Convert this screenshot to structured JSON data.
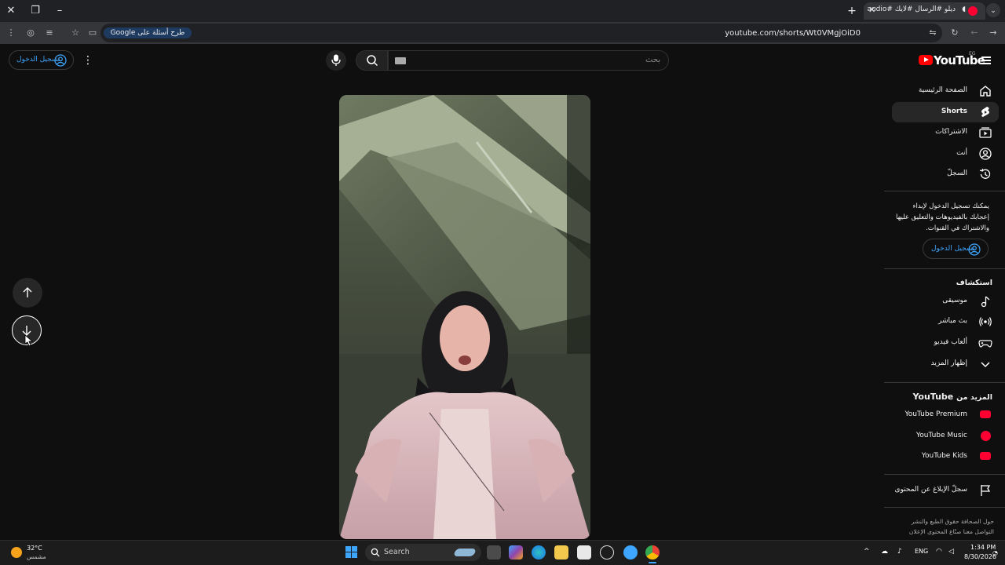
{
  "browser": {
    "tab_title": "ديلو #الرسال #لايك #audio",
    "tab_audio_icon": "speaker-icon",
    "url": "youtube.com/shorts/Wt0VMgjOiD0",
    "gemini_chip": "طرح أسئلة على Google",
    "new_tab": "+"
  },
  "header": {
    "logo": "YouTube",
    "country_code": "EG",
    "search_placeholder": "بحث",
    "signin_label": "تسجيل الدخول"
  },
  "sidebar": {
    "items": [
      {
        "label": "الصفحة الرئيسية",
        "icon": "home-icon"
      },
      {
        "label": "Shorts",
        "icon": "shorts-icon"
      },
      {
        "label": "الاشتراكات",
        "icon": "subscriptions-icon"
      },
      {
        "label": "أنت",
        "icon": "you-icon"
      },
      {
        "label": "السجلّ",
        "icon": "history-icon"
      }
    ],
    "signin_message": "يمكنك تسجيل الدخول لإبداء إعجابك بالفيديوهات والتعليق عليها والاشتراك في القنوات.",
    "signin_label": "تسجيل الدخول",
    "explore_title": "استكشاف",
    "explore_items": [
      {
        "label": "موسيقى",
        "icon": "music-icon"
      },
      {
        "label": "بث مباشر",
        "icon": "live-icon"
      },
      {
        "label": "ألعاب فيديو",
        "icon": "gaming-icon"
      },
      {
        "label": "إظهار المزيد",
        "icon": "chevron-down-icon"
      }
    ],
    "more_title_prefix": "المزيد من",
    "more_title_brand": "YouTube",
    "more_items": [
      {
        "label": "YouTube Premium",
        "icon": "youtube-premium-icon"
      },
      {
        "label": "YouTube Music",
        "icon": "youtube-music-icon"
      },
      {
        "label": "YouTube Kids",
        "icon": "youtube-kids-icon"
      }
    ],
    "report_label": "سجلّ الإبلاغ عن المحتوى",
    "footer_line1": "حول  الصحافة  حقوق الطبع والنشر",
    "footer_line2": "التواصل معنا  صنّاع المحتوى  الإعلان"
  },
  "taskbar": {
    "temperature": "32°C",
    "condition": "مشمس",
    "search_label": "Search",
    "language": "ENG",
    "time": "1:34 PM",
    "date": "8/30/2026"
  },
  "colors": {
    "background": "#0f0f0f",
    "brand_red": "#ff0000",
    "link_blue": "#3ea6ff",
    "active_item": "#272727"
  }
}
